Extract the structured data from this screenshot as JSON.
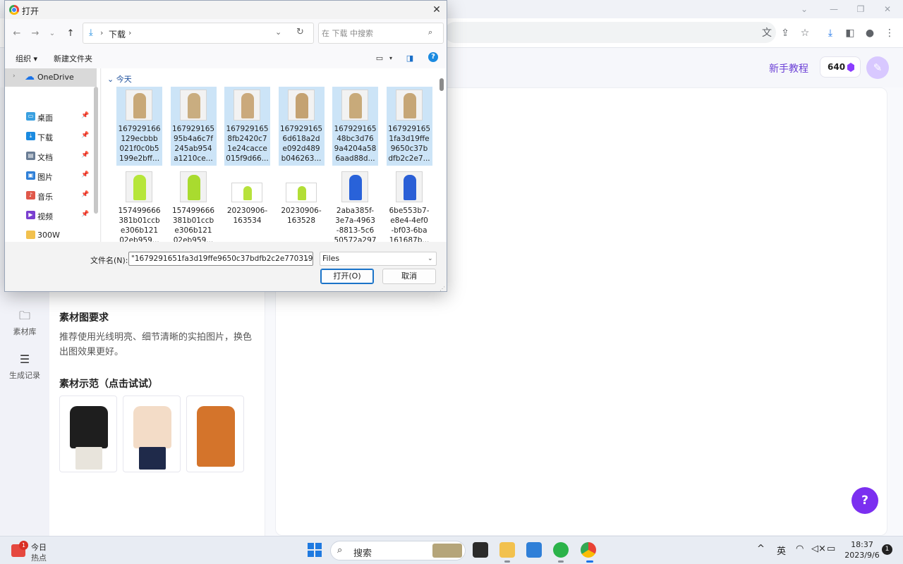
{
  "dialog": {
    "title": "打开",
    "address": {
      "folder": "下载",
      "arrow": "›"
    },
    "search_placeholder": "在 下载 中搜索",
    "commands": {
      "organize": "组织",
      "new_folder": "新建文件夹"
    },
    "nav_items": [
      {
        "label": "OneDrive",
        "icon": "cloud-icon",
        "color": "#1a73e8",
        "pinned": false,
        "selected": true,
        "expander": "›"
      },
      {
        "label": "桌面",
        "icon": "desktop-icon",
        "color": "#3aa0e0",
        "pinned": true
      },
      {
        "label": "下载",
        "icon": "download-icon",
        "color": "#1a8ae0",
        "pinned": true
      },
      {
        "label": "文档",
        "icon": "document-icon",
        "color": "#6a7d95",
        "pinned": true
      },
      {
        "label": "图片",
        "icon": "pictures-icon",
        "color": "#2f80d8",
        "pinned": true
      },
      {
        "label": "音乐",
        "icon": "music-icon",
        "color": "#e0584a",
        "pinned": true
      },
      {
        "label": "视频",
        "icon": "video-icon",
        "color": "#7a3fd0",
        "pinned": true
      },
      {
        "label": "300W",
        "icon": "folder-icon",
        "color": "#f2c14e",
        "pinned": false
      }
    ],
    "group_header": "今天",
    "files": [
      {
        "name": "1679291661 29ecbbb021f0c0b5199e2bff...",
        "lines": [
          "167929166",
          "129ecbbb",
          "021f0c0b5",
          "199e2bff..."
        ],
        "selected": true,
        "color": "#c8a878",
        "wide": false
      },
      {
        "name": "167929165 95b4a6c7f245ab954a1210ce...",
        "lines": [
          "167929165",
          "95b4a6c7f",
          "245ab954",
          "a1210ce..."
        ],
        "selected": true,
        "color": "#c9ad80",
        "wide": false
      },
      {
        "name": "167929165 8fb2420c71e24cacce015f9d66...",
        "lines": [
          "167929165",
          "8fb2420c7",
          "1e24cacce",
          "015f9d66..."
        ],
        "selected": true,
        "color": "#caa97c",
        "wide": false
      },
      {
        "name": "167929165 6d618a2de092d489b046263...",
        "lines": [
          "167929165",
          "6d618a2d",
          "e092d489",
          "b046263..."
        ],
        "selected": true,
        "color": "#c4a272",
        "wide": false
      },
      {
        "name": "167929165 48bc3d769a4204a586aad88d...",
        "lines": [
          "167929165",
          "48bc3d76",
          "9a4204a58",
          "6aad88d..."
        ],
        "selected": true,
        "color": "#c8aa7a",
        "wide": false
      },
      {
        "name": "167929165 1fa3d19ffe9650c37bdfb2c2e7...",
        "lines": [
          "167929165",
          "1fa3d19ffe",
          "9650c37b",
          "dfb2c2e7..."
        ],
        "selected": true,
        "color": "#c6a676",
        "wide": false
      },
      {
        "name": "157499666 381b01ccbe306b12102eb959...",
        "lines": [
          "157499666",
          "381b01ccb",
          "e306b121",
          "02eb959..."
        ],
        "selected": false,
        "color": "#b6e63a",
        "wide": false
      },
      {
        "name": "157499666 381b01ccbe306b12102eb959...",
        "lines": [
          "157499666",
          "381b01ccb",
          "e306b121",
          "02eb959..."
        ],
        "selected": false,
        "color": "#a9db2f",
        "wide": false
      },
      {
        "name": "20230906-163534",
        "lines": [
          "20230906-",
          "163534"
        ],
        "selected": false,
        "color": "#b7e23c",
        "wide": true
      },
      {
        "name": "20230906-163528",
        "lines": [
          "20230906-",
          "163528"
        ],
        "selected": false,
        "color": "#b2de36",
        "wide": true
      },
      {
        "name": "2aba385f-3e7a-4963-8813-5c650572a297",
        "lines": [
          "2aba385f-",
          "3e7a-4963",
          "-8813-5c6",
          "50572a297"
        ],
        "selected": false,
        "color": "#2962d9",
        "wide": false
      },
      {
        "name": "6be553b7-e8e4-4ef0-bf03-6ba161687b...",
        "lines": [
          "6be553b7-",
          "e8e4-4ef0",
          "-bf03-6ba",
          "161687b..."
        ],
        "selected": false,
        "color": "#2a5fd6",
        "wide": false
      }
    ],
    "filename_label": "文件名(N):",
    "filename_value": "\"1679291651fa3d19ffe9650c37bdfb2c2e7703193",
    "filetype": "Files",
    "open_button": "打开(O)",
    "cancel_button": "取消"
  },
  "site": {
    "tutorial": "新手教程",
    "credits": "640",
    "rail": [
      {
        "label": "素材库",
        "icon": "folder-icon"
      },
      {
        "label": "生成记录",
        "icon": "list-icon"
      }
    ],
    "requirements_title": "素材图要求",
    "requirements_text": "推荐使用光线明亮、细节清晰的实拍图片，换色出图效果更好。",
    "demo_title": "素材示范（点击试试）",
    "demo_colors": [
      "#1e1e1e",
      "#f3dcc7",
      "#d4742b"
    ],
    "help": "?"
  },
  "taskbar": {
    "weather_badge": "1",
    "weather_line1": "今日",
    "weather_line2": "热点",
    "search": "搜索",
    "ime": "英",
    "time": "18:37",
    "date": "2023/9/6",
    "notifications": "1"
  }
}
